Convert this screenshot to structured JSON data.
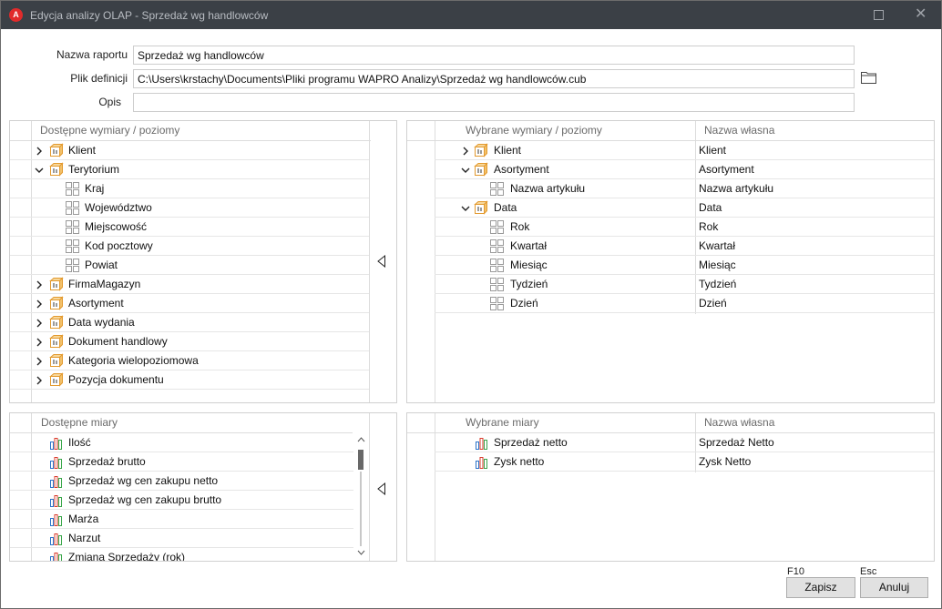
{
  "window": {
    "title": "Edycja analizy OLAP - Sprzedaż wg handlowców",
    "app_icon_letter": "A"
  },
  "form": {
    "report_name_label": "Nazwa raportu",
    "report_name_value": "Sprzedaż wg handlowców",
    "definition_file_label": "Plik definicji",
    "definition_file_value": "C:\\Users\\krstachy\\Documents\\Pliki programu WAPRO Analizy\\Sprzedaż wg handlowców.cub",
    "description_label": "Opis",
    "description_value": ""
  },
  "available_dimensions": {
    "header": "Dostępne wymiary / poziomy",
    "rows": [
      {
        "label": "Klient",
        "type": "dimension",
        "expanded": false
      },
      {
        "label": "Terytorium",
        "type": "dimension",
        "expanded": true
      },
      {
        "label": "Kraj",
        "type": "level"
      },
      {
        "label": "Województwo",
        "type": "level"
      },
      {
        "label": "Miejscowość",
        "type": "level"
      },
      {
        "label": "Kod pocztowy",
        "type": "level"
      },
      {
        "label": "Powiat",
        "type": "level"
      },
      {
        "label": "FirmaMagazyn",
        "type": "dimension",
        "expanded": false
      },
      {
        "label": "Asortyment",
        "type": "dimension",
        "expanded": false
      },
      {
        "label": "Data wydania",
        "type": "dimension",
        "expanded": false
      },
      {
        "label": "Dokument handlowy",
        "type": "dimension",
        "expanded": false
      },
      {
        "label": "Kategoria wielopoziomowa",
        "type": "dimension",
        "expanded": false
      },
      {
        "label": "Pozycja dokumentu",
        "type": "dimension",
        "expanded": false
      }
    ]
  },
  "selected_dimensions": {
    "header": "Wybrane wymiary / poziomy",
    "header_custom": "Nazwa własna",
    "rows": [
      {
        "label": "Klient",
        "custom": "Klient",
        "type": "dimension",
        "expanded": false
      },
      {
        "label": "Asortyment",
        "custom": "Asortyment",
        "type": "dimension",
        "expanded": true
      },
      {
        "label": "Nazwa artykułu",
        "custom": "Nazwa artykułu",
        "type": "level"
      },
      {
        "label": "Data",
        "custom": "Data",
        "type": "dimension",
        "expanded": true
      },
      {
        "label": "Rok",
        "custom": "Rok",
        "type": "level"
      },
      {
        "label": "Kwartał",
        "custom": "Kwartał",
        "type": "level"
      },
      {
        "label": "Miesiąc",
        "custom": "Miesiąc",
        "type": "level"
      },
      {
        "label": "Tydzień",
        "custom": "Tydzień",
        "type": "level"
      },
      {
        "label": "Dzień",
        "custom": "Dzień",
        "type": "level"
      }
    ]
  },
  "available_measures": {
    "header": "Dostępne miary",
    "rows": [
      {
        "label": "Ilość"
      },
      {
        "label": "Sprzedaż brutto"
      },
      {
        "label": "Sprzedaż wg cen zakupu netto"
      },
      {
        "label": "Sprzedaż wg cen zakupu brutto"
      },
      {
        "label": "Marża"
      },
      {
        "label": "Narzut"
      },
      {
        "label": "Zmiana Sprzedaży (rok)"
      }
    ]
  },
  "selected_measures": {
    "header": "Wybrane miary",
    "header_custom": "Nazwa własna",
    "rows": [
      {
        "label": "Sprzedaż netto",
        "custom": "Sprzedaż Netto"
      },
      {
        "label": "Zysk netto",
        "custom": "Zysk Netto"
      }
    ]
  },
  "footer": {
    "save_shortcut": "F10",
    "save_label": "Zapisz",
    "cancel_shortcut": "Esc",
    "cancel_label": "Anuluj"
  },
  "icons": {
    "expander_collapsed": "chevron-right-icon",
    "expander_expanded": "chevron-down-icon",
    "dimension": "cube-dimension-icon",
    "level": "level-grid-icon",
    "measure": "bar-chart-measure-icon",
    "move_left": "triangle-left-icon",
    "move_right": "triangle-right-icon",
    "folder": "folder-icon"
  },
  "colors": {
    "titlebar": "#3b4046",
    "app_icon": "#e12b2b",
    "dimension_icon": "#e8a23a",
    "measure_red": "#d9392a",
    "measure_green": "#3aa64a",
    "measure_blue": "#2a72c9"
  }
}
